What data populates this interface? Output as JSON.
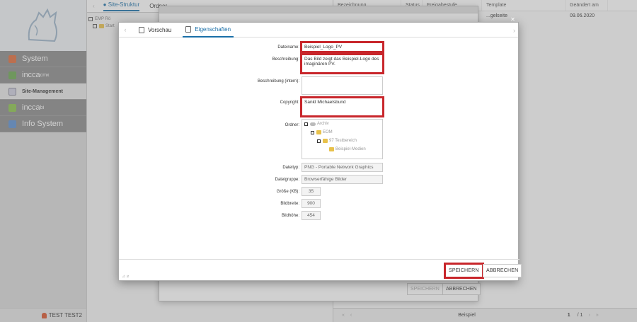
{
  "sidebar": {
    "items": [
      {
        "label": "System",
        "icon": "system-icon"
      },
      {
        "label": "incca",
        "sup": "cmx",
        "icon": "incca-cmx-icon"
      },
      {
        "label": "Site-Management",
        "icon": "site-management-icon"
      },
      {
        "label": "incca",
        "sup": "bi",
        "icon": "incca-bi-icon"
      },
      {
        "label": "Info System",
        "icon": "info-system-icon"
      }
    ],
    "user": "TEST TEST2"
  },
  "tree": {
    "tabs": [
      "Site-Struktur",
      "Ordner"
    ],
    "root": "EMP Rö",
    "second": "Start"
  },
  "list": {
    "columns": [
      "Bezeichnung",
      "Status",
      "Freigabestufe",
      "Template",
      "Geändert am"
    ],
    "row": {
      "template": "...gelseite",
      "date": "09.06.2020"
    },
    "footer": {
      "name": "Beispiel",
      "page": "1",
      "total": "/ 1"
    }
  },
  "bg_dialog": {
    "save": "SPEICHERN",
    "cancel": "ABBRECHEN"
  },
  "dialog": {
    "tabs": [
      {
        "label": "Vorschau",
        "icon": "preview-icon"
      },
      {
        "label": "Eigenschaften",
        "icon": "properties-icon"
      }
    ],
    "fields": {
      "dateiname": {
        "label": "Dateiname:",
        "value": "Beispiel_Logo_PV"
      },
      "beschreibung": {
        "label": "Beschreibung:",
        "value": "Das Bild zeigt das Beispiel-Logo des imaginären PV."
      },
      "beschreibung_intern": {
        "label": "Beschreibung (intern):",
        "value": ""
      },
      "copyright": {
        "label": "Copyright:",
        "value": "Sankt Michaelsbund"
      },
      "ordner": {
        "label": "Ordner:"
      },
      "dateityp": {
        "label": "Dateityp:",
        "value": "PNG - Portable Network Graphics"
      },
      "dateigruppe": {
        "label": "Dateigruppe:",
        "value": "Browserfähige Bilder"
      },
      "groesse": {
        "label": "Größe (KB):",
        "value": "35"
      },
      "bildbreite": {
        "label": "Bildbreite:",
        "value": "900"
      },
      "bildhoehe": {
        "label": "Bildhöhe:",
        "value": "454"
      }
    },
    "folders": [
      "Archiv",
      "EOM",
      "97 Testbereich",
      "Beispiel-Medien"
    ],
    "save": "SPEICHERN",
    "cancel": "ABBRECHEN"
  },
  "colors": {
    "highlight": "#c8262b",
    "accent": "#1a6fa8"
  }
}
